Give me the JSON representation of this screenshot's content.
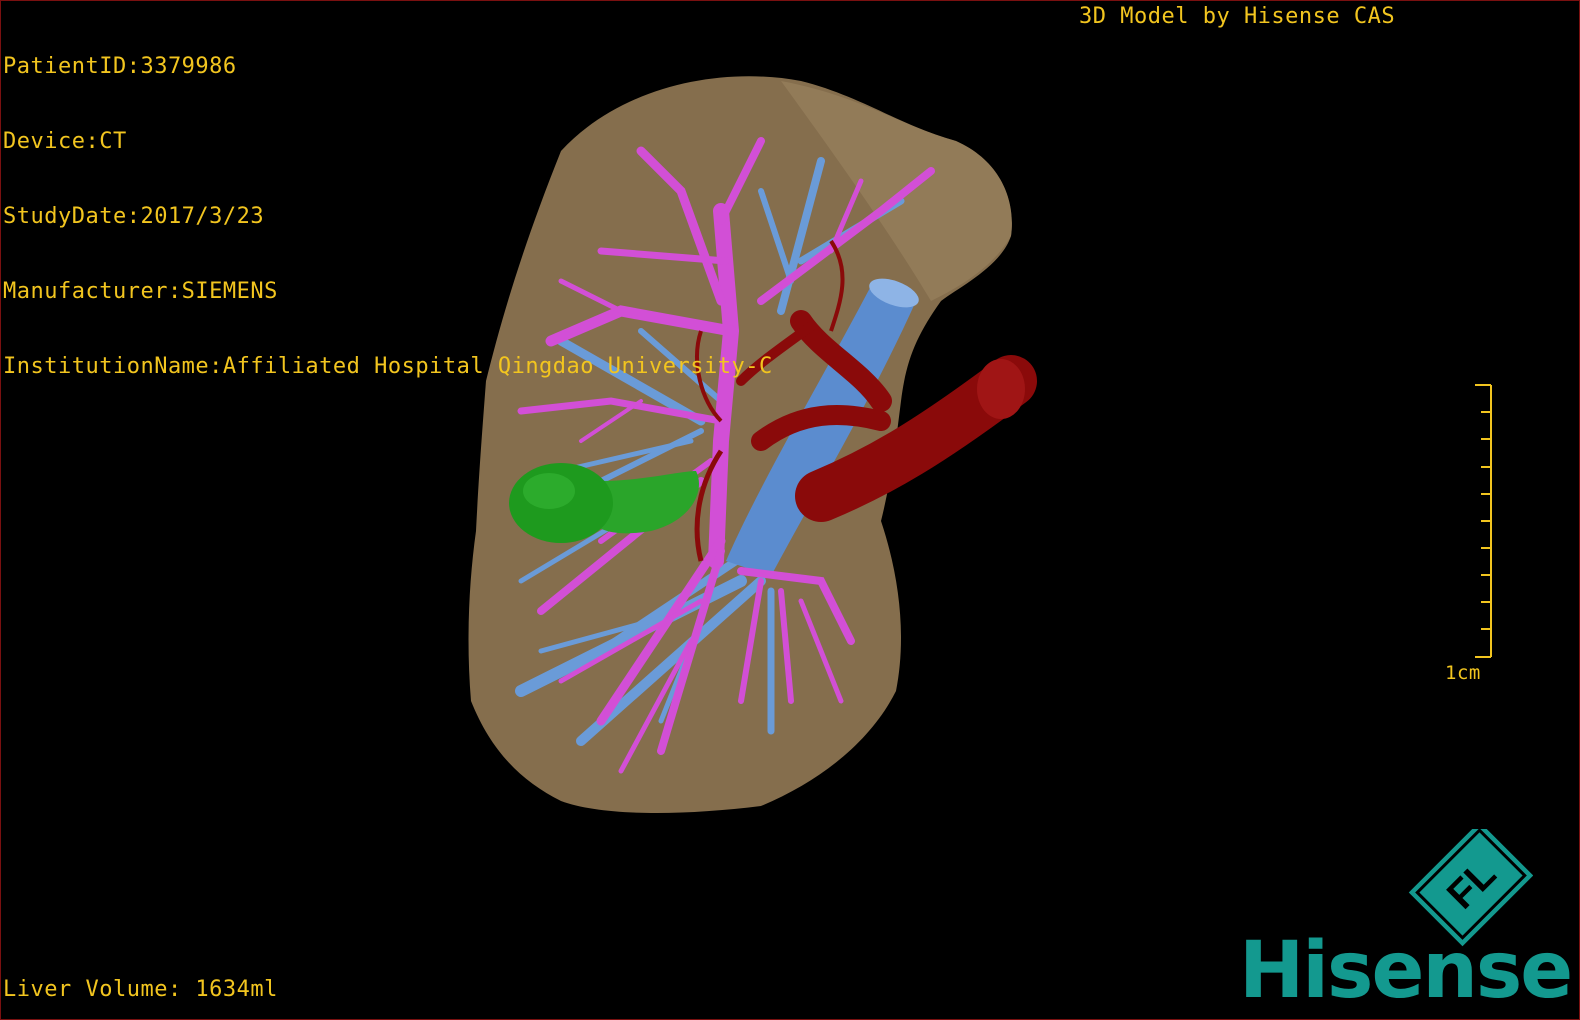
{
  "patient_info": {
    "patient_id": "PatientID:3379986",
    "device": "Device:CT",
    "study_date": "StudyDate:2017/3/23",
    "manufacturer": "Manufacturer:SIEMENS",
    "institution": "InstitutionName:Affiliated Hospital Qingdao University-C"
  },
  "header_right": "3D Model by Hisense CAS",
  "liver_volume": "Liver Volume: 1634ml",
  "scale": {
    "label": "1cm"
  },
  "brand": {
    "logo_text": "FL",
    "name": "Hisense"
  },
  "colors": {
    "overlay_text": "#f2c51f",
    "liver": "#8a7350",
    "portal_vein": "#d24fd6",
    "hepatic_vein": "#6a9bd8",
    "artery": "#8a0a0a",
    "gallbladder": "#1e9a1e",
    "brand": "#13998f"
  }
}
